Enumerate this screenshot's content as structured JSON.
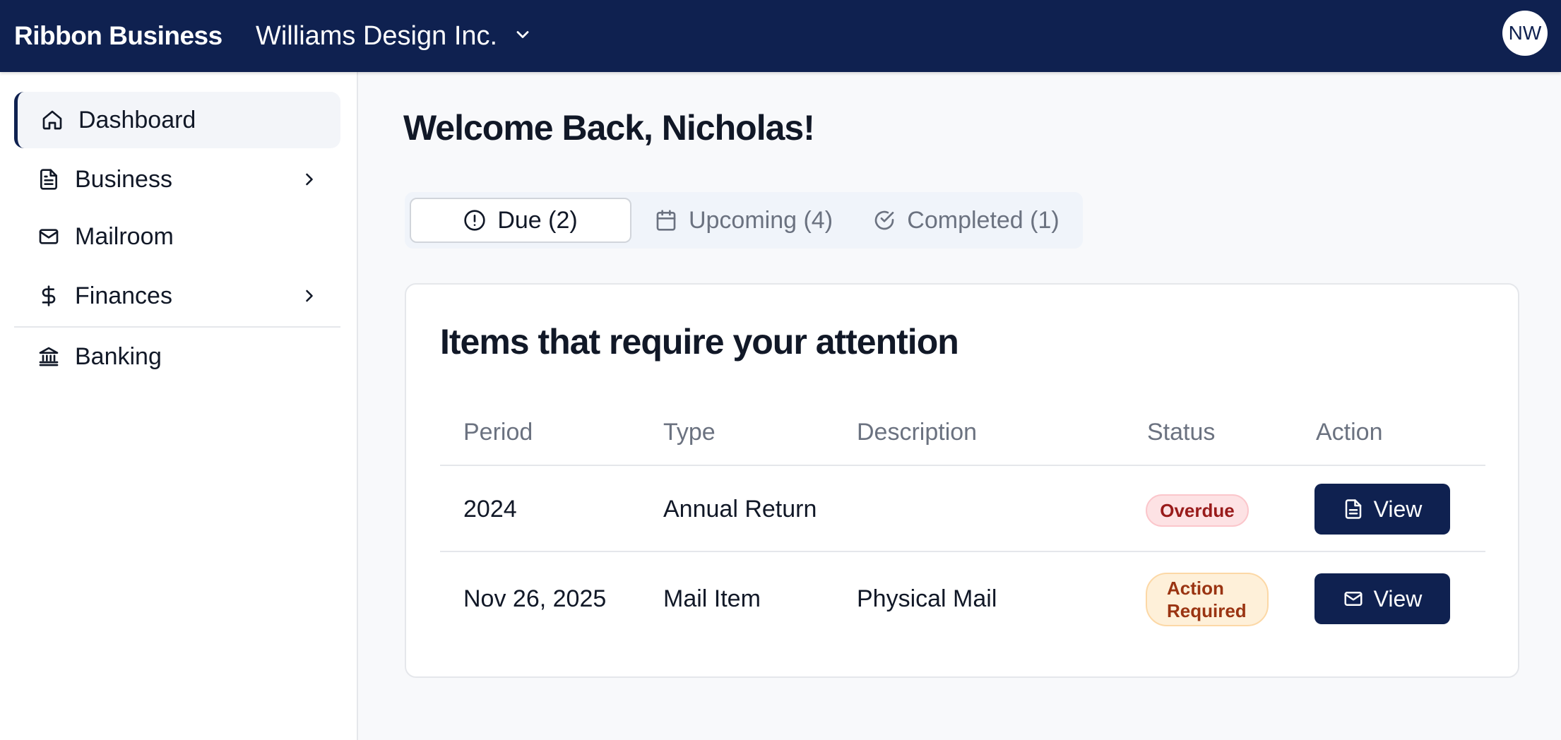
{
  "header": {
    "brand": "Ribbon Business",
    "company": "Williams Design Inc.",
    "avatar_initials": "NW",
    "bg_color": "#0f2150"
  },
  "sidebar": {
    "items": [
      {
        "label": "Dashboard",
        "icon": "home-icon",
        "active": true
      },
      {
        "label": "Business",
        "icon": "document-icon",
        "has_submenu": true
      },
      {
        "label": "Mailroom",
        "icon": "mail-icon"
      },
      {
        "label": "Finances",
        "icon": "dollar-icon",
        "has_submenu": true
      },
      {
        "label": "Banking",
        "icon": "bank-icon"
      }
    ]
  },
  "main": {
    "welcome": "Welcome Back, Nicholas!",
    "tabs": [
      {
        "label": "Due (2)",
        "icon": "alert-circle-icon",
        "active": true
      },
      {
        "label": "Upcoming (4)",
        "icon": "calendar-icon"
      },
      {
        "label": "Completed (1)",
        "icon": "check-circle-icon"
      }
    ],
    "card": {
      "title": "Items that require your attention",
      "columns": [
        "Period",
        "Type",
        "Description",
        "Status",
        "Action"
      ],
      "rows": [
        {
          "period": "2024",
          "type": "Annual Return",
          "description": "",
          "status": "Overdue",
          "action": "View",
          "action_icon": "document-icon"
        },
        {
          "period": "Nov 26, 2025",
          "type": "Mail Item",
          "description": "Physical Mail",
          "status_line1": "Action",
          "status_line2": "Required",
          "action": "View",
          "action_icon": "mail-icon"
        }
      ]
    }
  }
}
